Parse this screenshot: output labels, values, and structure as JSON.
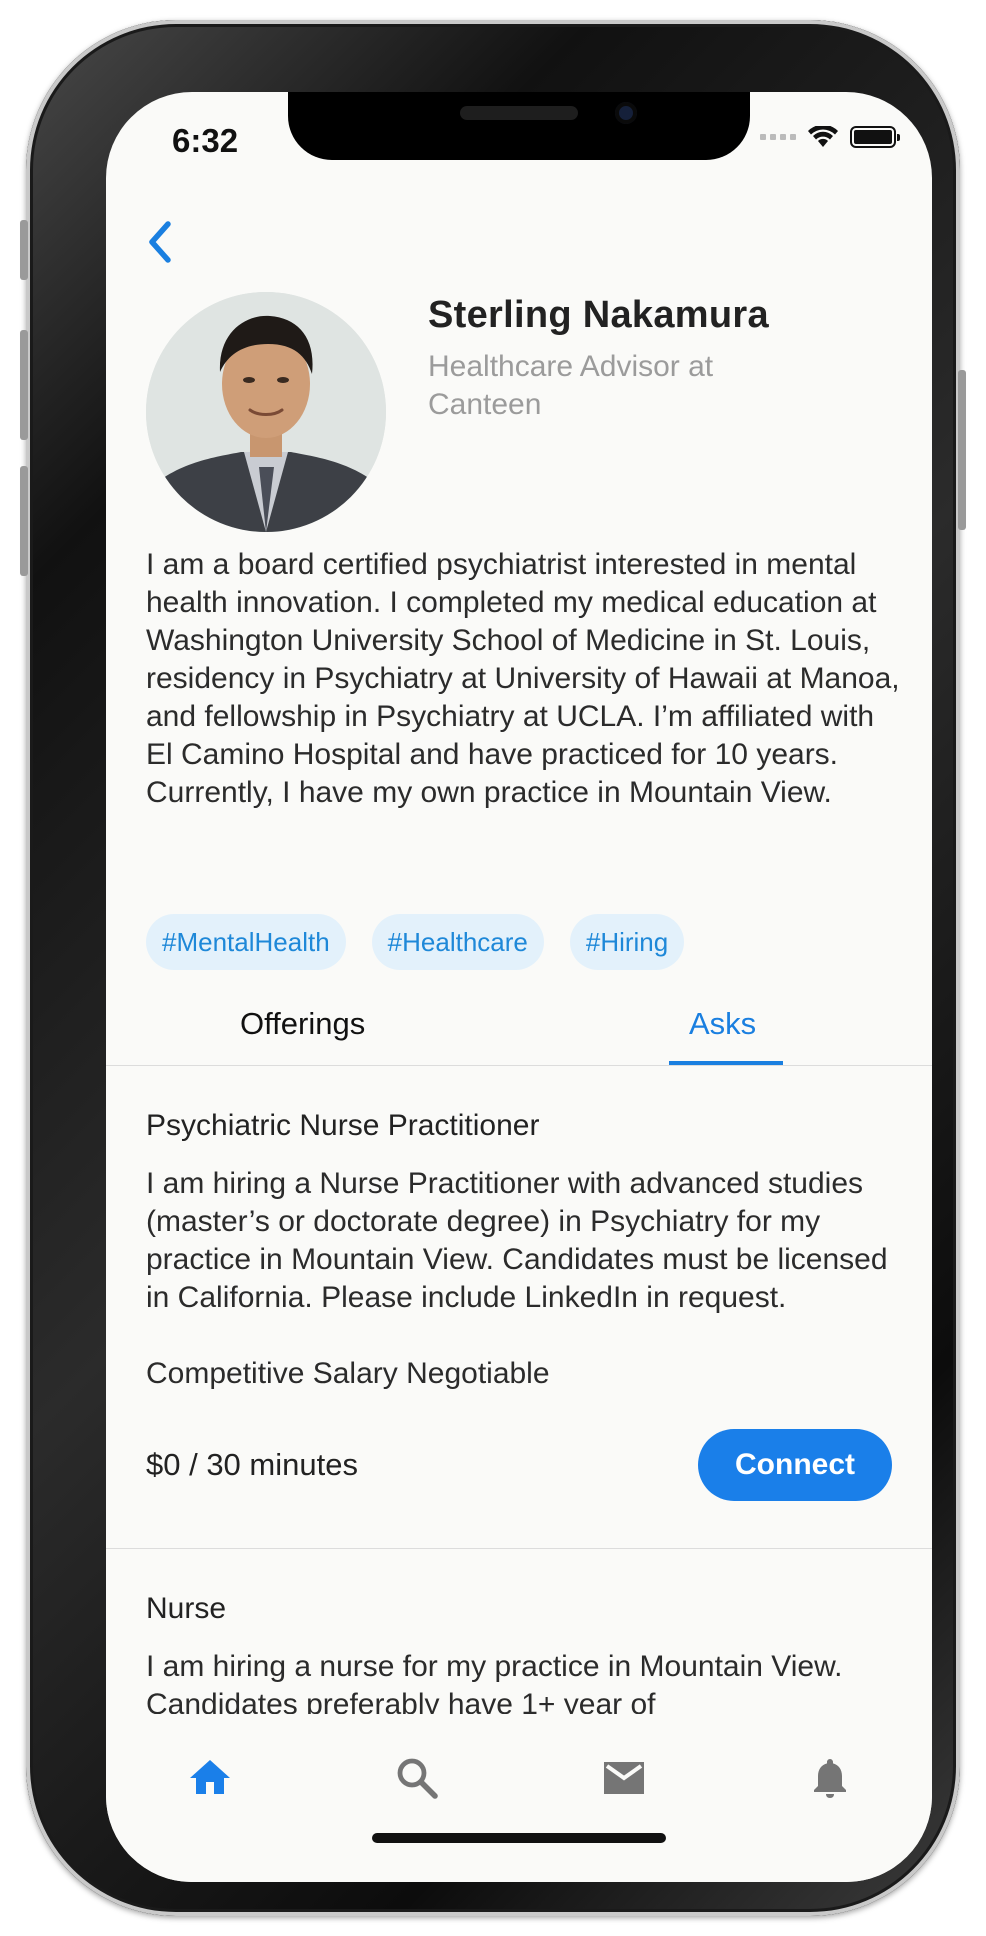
{
  "status_bar": {
    "time": "6:32"
  },
  "profile": {
    "name": "Sterling Nakamura",
    "role": "Healthcare Advisor at Canteen",
    "bio": "I am a board certified psychiatrist interested in mental health innovation. I completed my medical education at Washington University School of Medicine in St. Louis, residency in Psychiatry at University of Hawaii at Manoa, and fellowship in Psychiatry at UCLA. I’m affiliated with El Camino Hospital and have practiced for 10 years. Currently, I have my own practice in Mountain View.",
    "tags": [
      "#MentalHealth",
      "#Healthcare",
      "#Hiring"
    ]
  },
  "tabs": {
    "offerings": "Offerings",
    "asks": "Asks",
    "active": "Asks"
  },
  "asks": [
    {
      "title": "Psychiatric Nurse Practitioner",
      "description": "I am hiring a Nurse Practitioner with advanced studies (master’s or doctorate degree) in Psychiatry for my practice in Mountain View. Candidates must be licensed in California. Please include LinkedIn in request.",
      "extra": "Competitive Salary Negotiable",
      "price": "$0 / 30 minutes",
      "button": "Connect"
    },
    {
      "title": "Nurse",
      "description": "I am hiring a nurse for my practice in Mountain View. Candidates preferably have 1+ year of"
    }
  ],
  "bottom_nav": {
    "items": [
      "home-icon",
      "search-icon",
      "mail-icon",
      "bell-icon"
    ],
    "active": "home-icon"
  },
  "colors": {
    "accent": "#1a7fe9",
    "tag_bg": "#e3f1fb",
    "muted": "#9b9b9b",
    "inactive_icon": "#757575"
  }
}
